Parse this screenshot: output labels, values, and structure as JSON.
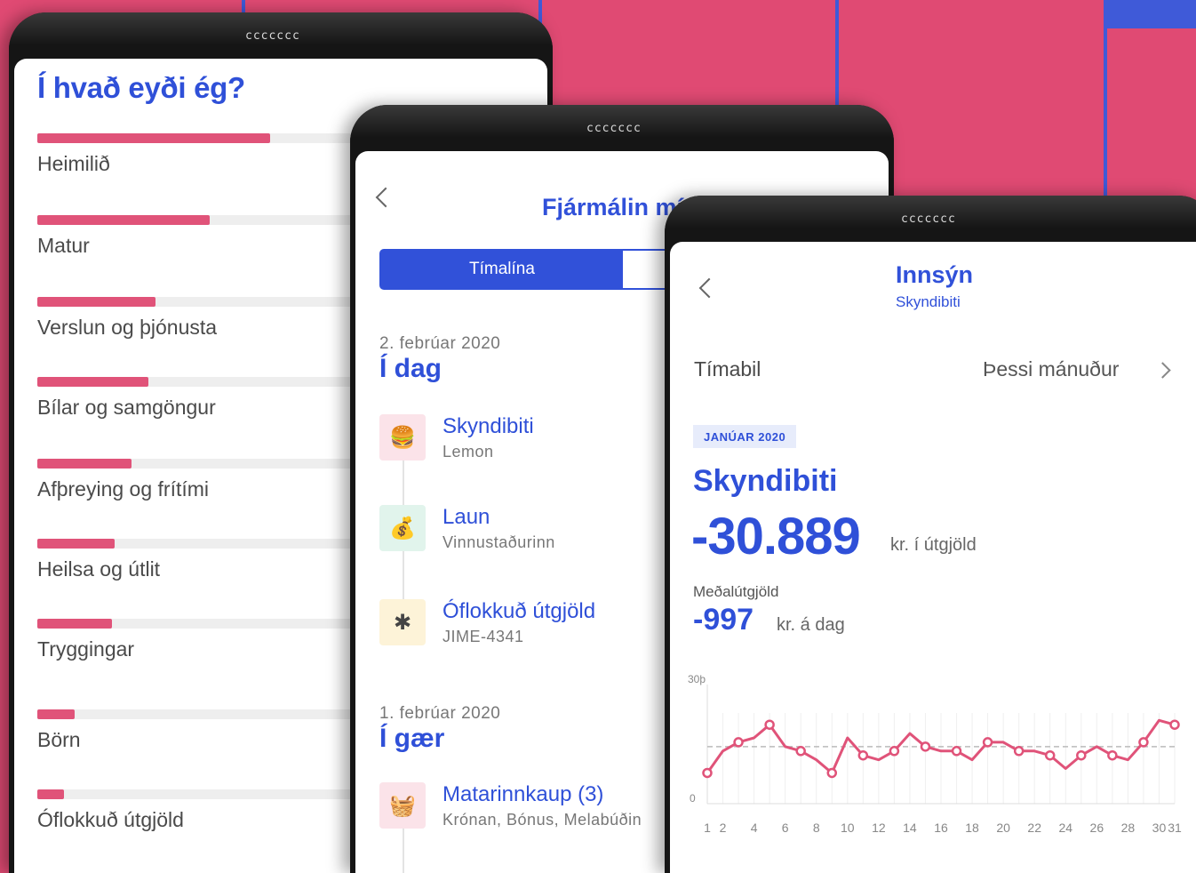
{
  "colors": {
    "background": "#e04a73",
    "accent": "#2f50d8",
    "bar": "#e05379"
  },
  "speaker_text": "ccccccc",
  "spending": {
    "title": "Í hvað eyði ég?",
    "categories": [
      {
        "label": "Heimilið",
        "share": 0.69
      },
      {
        "label": "Matur",
        "share": 0.51
      },
      {
        "label": "Verslun og þjónusta",
        "share": 0.35
      },
      {
        "label": "Bílar og samgöngur",
        "share": 0.33
      },
      {
        "label": "Afþreying og frítími",
        "share": 0.28
      },
      {
        "label": "Heilsa og útlit",
        "share": 0.23
      },
      {
        "label": "Tryggingar",
        "share": 0.22
      },
      {
        "label": "Börn",
        "share": 0.11
      },
      {
        "label": "Óflokkuð útgjöld",
        "share": 0.08
      }
    ]
  },
  "finances": {
    "title": "Fjármálin mín",
    "segment_active": "Tímalína",
    "groups": [
      {
        "date": "2. febrúar 2020",
        "heading": "Í dag",
        "items": [
          {
            "name": "Skyndibiti",
            "sub": "Lemon",
            "icon": "burger-icon",
            "glyph": "🍔",
            "bg": "#fbe3e9"
          },
          {
            "name": "Laun",
            "sub": "Vinnustaðurinn",
            "icon": "money-hand-icon",
            "glyph": "💰",
            "bg": "#e1f4ec"
          },
          {
            "name": "Óflokkuð útgjöld",
            "sub": "JIME-4341",
            "icon": "asterisk-icon",
            "glyph": "✱",
            "bg": "#fdf3d8"
          }
        ]
      },
      {
        "date": "1. febrúar 2020",
        "heading": "Í gær",
        "items": [
          {
            "name": "Matarinnkaup (3)",
            "sub": "Krónan, Bónus, Melabúðin",
            "icon": "basket-icon",
            "glyph": "🧺",
            "bg": "#fbe3e9"
          }
        ]
      }
    ]
  },
  "insight": {
    "title": "Innsýn",
    "subtitle": "Skyndibiti",
    "period_label": "Tímabil",
    "period_value": "Þessi mánuður",
    "month_badge": "JANÚAR 2020",
    "category": "Skyndibiti",
    "amount": "-30.889",
    "amount_unit": "kr. í útgjöld",
    "avg_label": "Meðalútgjöld",
    "avg_value": "-997",
    "avg_unit": "kr. á dag"
  },
  "chart_data": {
    "type": "line",
    "y_tick_labels": [
      "30þ",
      "0"
    ],
    "x_tick_labels": [
      "1",
      "2",
      "4",
      "6",
      "8",
      "10",
      "12",
      "14",
      "16",
      "18",
      "20",
      "22",
      "24",
      "26",
      "28",
      "30",
      "31"
    ],
    "x": [
      1,
      2,
      3,
      4,
      5,
      6,
      7,
      8,
      9,
      10,
      11,
      12,
      13,
      14,
      15,
      16,
      17,
      18,
      19,
      20,
      21,
      22,
      23,
      24,
      25,
      26,
      27,
      28,
      29,
      30,
      31
    ],
    "values": [
      7,
      12,
      14,
      15,
      18,
      13,
      12,
      10,
      7,
      15,
      11,
      10,
      12,
      16,
      13,
      12,
      12,
      10,
      14,
      14,
      12,
      12,
      11,
      8,
      11,
      13,
      11,
      10,
      14,
      19,
      18
    ],
    "reference_line": 13,
    "ylim": [
      0,
      30
    ]
  }
}
